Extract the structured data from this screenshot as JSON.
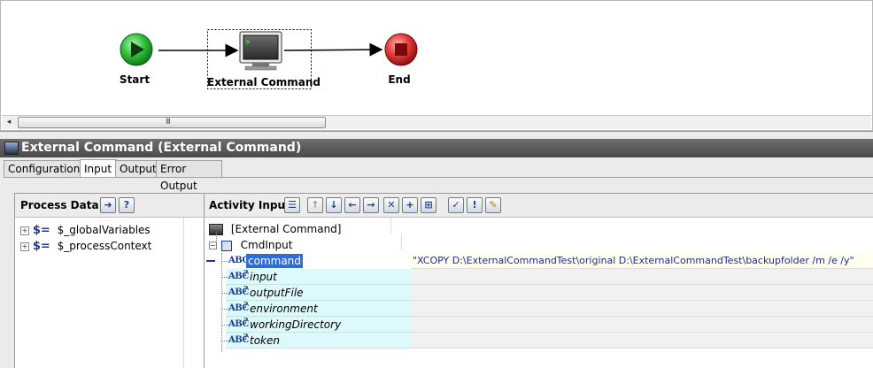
{
  "flow": {
    "start_label": "Start",
    "task_label": "External Command",
    "end_label": "End"
  },
  "scrollbar": {
    "left_arrow": "◂",
    "grip": "III"
  },
  "title_bar": {
    "title": "External Command (External Command)"
  },
  "tabs": [
    {
      "label": "Configuration",
      "active": false
    },
    {
      "label": "Input",
      "active": true
    },
    {
      "label": "Output",
      "active": false
    },
    {
      "label": "Error Output",
      "active": false
    }
  ],
  "process_data": {
    "title": "Process Data:",
    "items": [
      {
        "icon": "$=",
        "label": "$_globalVariables"
      },
      {
        "icon": "$=",
        "label": "$_processContext"
      }
    ]
  },
  "activity_input": {
    "title": "Activity Input:",
    "root": "[External Command]",
    "group": "CmdInput",
    "fields": [
      {
        "name": "command",
        "optional": false,
        "selected": true,
        "value": "\"XCOPY D:\\ExternalCommandTest\\original D:\\ExternalCommandTest\\backupfolder /m /e /y\""
      },
      {
        "name": "input",
        "optional": true,
        "selected": false,
        "value": ""
      },
      {
        "name": "outputFile",
        "optional": true,
        "selected": false,
        "value": ""
      },
      {
        "name": "environment",
        "optional": true,
        "selected": false,
        "value": ""
      },
      {
        "name": "workingDirectory",
        "optional": true,
        "selected": false,
        "value": ""
      },
      {
        "name": "token",
        "optional": true,
        "selected": false,
        "value": ""
      }
    ],
    "abc_glyph": "ABC",
    "optional_mark": "?"
  },
  "colors": {
    "start_green": "#2fbf3a",
    "end_red": "#d7262b",
    "selection_blue": "#2e6dd8",
    "field_cyan": "#ddf9fb"
  }
}
